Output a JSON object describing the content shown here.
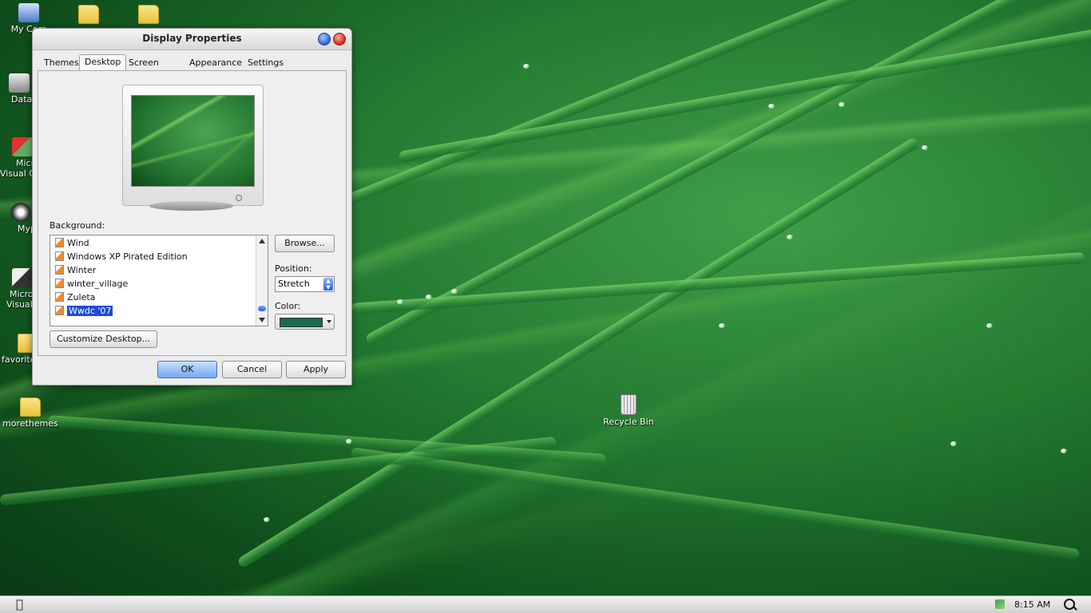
{
  "desktop": {
    "icons": [
      {
        "label": "My Computer",
        "visible_label": "My Com"
      },
      {
        "label": "",
        "visible_label": ""
      },
      {
        "label": "",
        "visible_label": ""
      },
      {
        "label": "DataW",
        "visible_label": "DataW"
      },
      {
        "label": "Micro Visual C",
        "visible_label": "Micro"
      },
      {
        "label": "Visual C",
        "visible_label": "Visual C"
      },
      {
        "label": "Myp",
        "visible_label": "Myp"
      },
      {
        "label": "Micro",
        "visible_label": "Micro"
      },
      {
        "label": "Visual",
        "visible_label": "Visual"
      },
      {
        "label": "favorite",
        "visible_label": "favorite"
      },
      {
        "label": "morethemes",
        "visible_label": "morethemes"
      },
      {
        "label": "Recycle Bin",
        "visible_label": "Recycle Bin"
      }
    ]
  },
  "window": {
    "title": "Display Properties",
    "tabs": [
      {
        "label": "Themes",
        "active": false
      },
      {
        "label": "Desktop",
        "active": true
      },
      {
        "label": "Screen Saver",
        "active": false
      },
      {
        "label": "Appearance",
        "active": false
      },
      {
        "label": "Settings",
        "active": false
      }
    ],
    "background_label": "Background:",
    "background_items": [
      {
        "label": "Wind",
        "selected": false
      },
      {
        "label": "Windows XP Pirated Edition",
        "selected": false
      },
      {
        "label": "Winter",
        "selected": false
      },
      {
        "label": "winter_village",
        "selected": false
      },
      {
        "label": "Zuleta",
        "selected": false
      },
      {
        "label": "Wwdc '07",
        "selected": true
      }
    ],
    "browse_label": "Browse...",
    "position_label": "Position:",
    "position_value": "Stretch",
    "color_label": "Color:",
    "color_value": "#1a6b4a",
    "customize_label": "Customize Desktop...",
    "ok_label": "OK",
    "cancel_label": "Cancel",
    "apply_label": "Apply"
  },
  "taskbar": {
    "apple_icon": "apple-icon",
    "time": "8:15 AM",
    "search_icon": "search-icon"
  }
}
